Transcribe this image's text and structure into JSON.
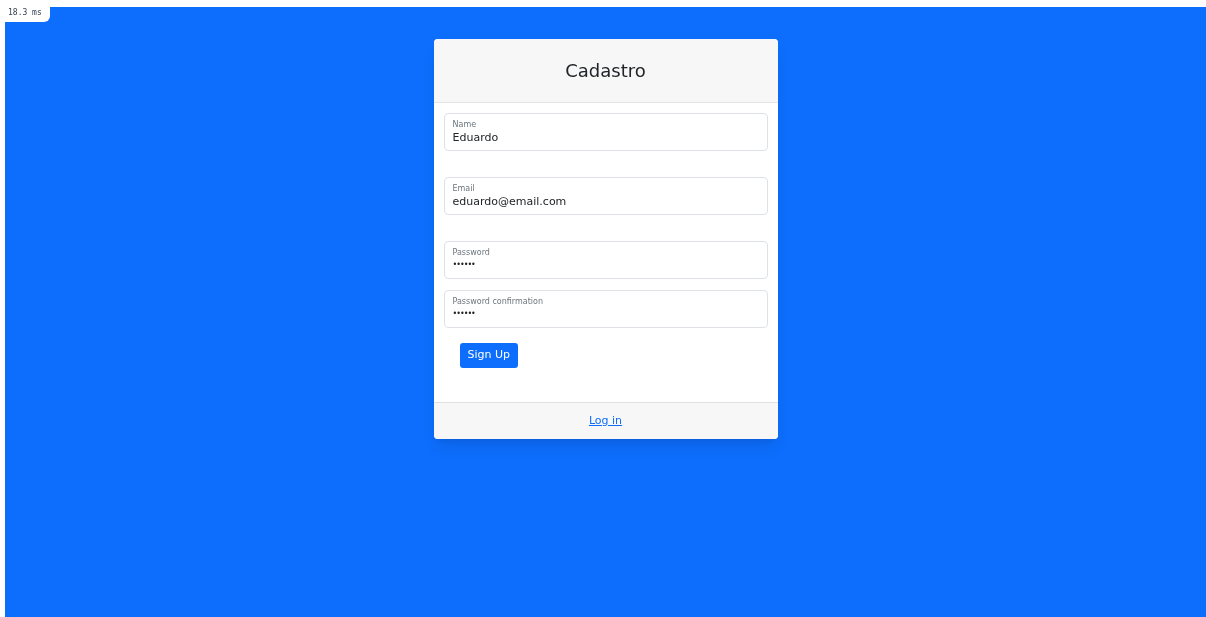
{
  "timing_badge": "18.3 ms",
  "card": {
    "title": "Cadastro",
    "fields": [
      {
        "label": "Name",
        "value": "Eduardo",
        "kind": "text"
      },
      {
        "label": "Email",
        "value": "eduardo@email.com",
        "kind": "text"
      },
      {
        "label": "Password",
        "value": "••••••",
        "kind": "password"
      },
      {
        "label": "Password confirmation",
        "value": "••••••",
        "kind": "password"
      }
    ],
    "submit_button": "Sign Up",
    "footer_link": "Log in"
  }
}
